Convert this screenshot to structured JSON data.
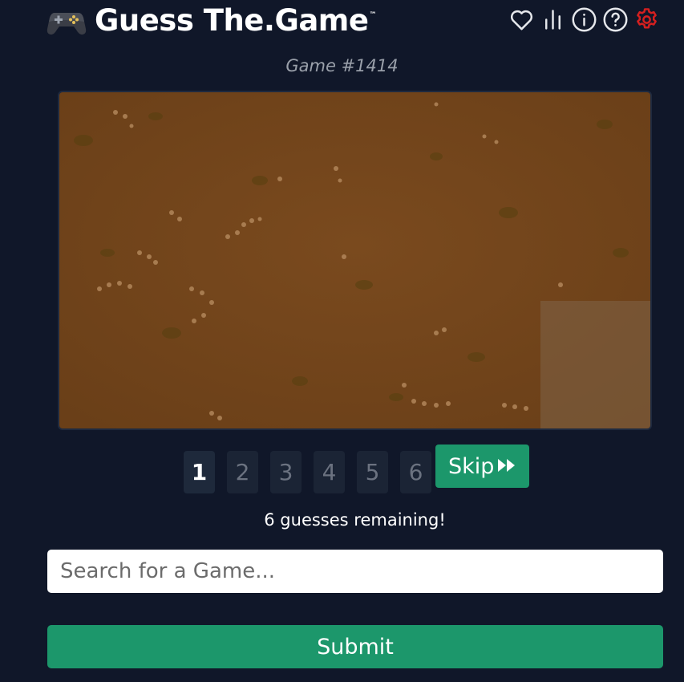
{
  "header": {
    "title": "Guess The.Game",
    "trademark": "™",
    "icons": [
      "controller-icon",
      "heart-icon",
      "stats-icon",
      "info-icon",
      "help-icon",
      "settings-icon"
    ],
    "accent_settings_color": "#d41f1f"
  },
  "game": {
    "number_label": "Game #1414"
  },
  "guesses": {
    "tabs": [
      "1",
      "2",
      "3",
      "4",
      "5",
      "6"
    ],
    "active_tab": "1",
    "skip_label": "Skip",
    "remaining_text": "6 guesses remaining!"
  },
  "search": {
    "placeholder": "Search for a Game...",
    "value": ""
  },
  "submit": {
    "label": "Submit"
  },
  "colors": {
    "background": "#101729",
    "primary_button": "#1c976b",
    "tab_bg": "#1b2435"
  }
}
